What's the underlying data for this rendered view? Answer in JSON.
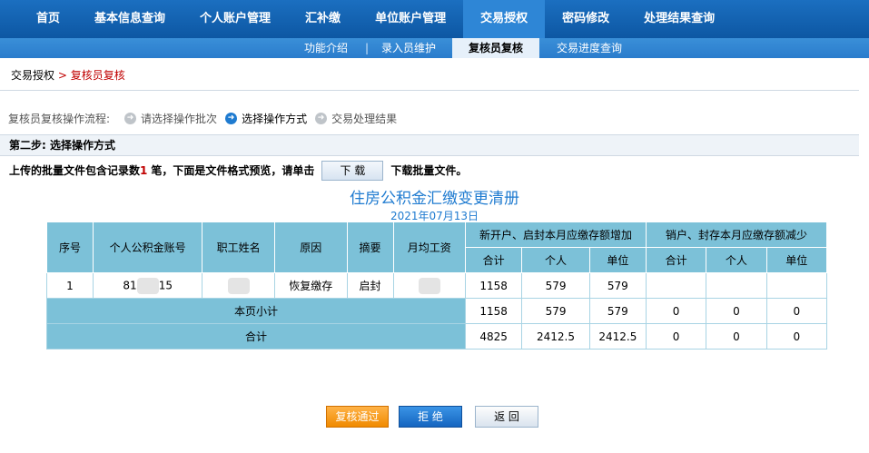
{
  "topnav": [
    "首页",
    "基本信息查询",
    "个人账户管理",
    "汇补缴",
    "单位账户管理",
    "交易授权",
    "密码修改",
    "处理结果查询"
  ],
  "subnav": [
    "功能介绍",
    "录入员维护",
    "复核员复核",
    "交易进度查询"
  ],
  "breadcrumb": {
    "root": "交易授权",
    "sep": ">",
    "current": "复核员复核"
  },
  "flow": {
    "label": "复核员复核操作流程:",
    "steps": [
      "请选择操作批次",
      "选择操作方式",
      "交易处理结果"
    ]
  },
  "step_title": "第二步: 选择操作方式",
  "info": {
    "prefix": "上传的批量文件包含记录数",
    "count": "1",
    "suffix": "笔，下面是文件格式预览，请单击",
    "button": "下 载",
    "tail": "下载批量文件。"
  },
  "report": {
    "title": "住房公积金汇缴变更清册",
    "date": "2021年07月13日"
  },
  "table": {
    "headers": [
      "序号",
      "个人公积金账号",
      "职工姓名",
      "原因",
      "摘要",
      "月均工资"
    ],
    "group_increase": "新开户、启封本月应缴存额增加",
    "group_decrease": "销户、封存本月应缴存额减少",
    "sub": [
      "合计",
      "个人",
      "单位",
      "合计",
      "个人",
      "单位"
    ],
    "row": {
      "no": "1",
      "acct_a": "81",
      "acct_b": "15",
      "reason": "恢复缴存",
      "summary": "启封",
      "inc": [
        "1158",
        "579",
        "579"
      ],
      "dec": [
        "",
        "",
        ""
      ]
    },
    "subtotal": {
      "label": "本页小计",
      "vals": [
        "1158",
        "579",
        "579",
        "0",
        "0",
        "0"
      ]
    },
    "total": {
      "label": "合计",
      "vals": [
        "4825",
        "2412.5",
        "2412.5",
        "0",
        "0",
        "0"
      ]
    }
  },
  "buttons": {
    "approve": "复核通过",
    "reject": "拒 绝",
    "back": "返 回"
  }
}
